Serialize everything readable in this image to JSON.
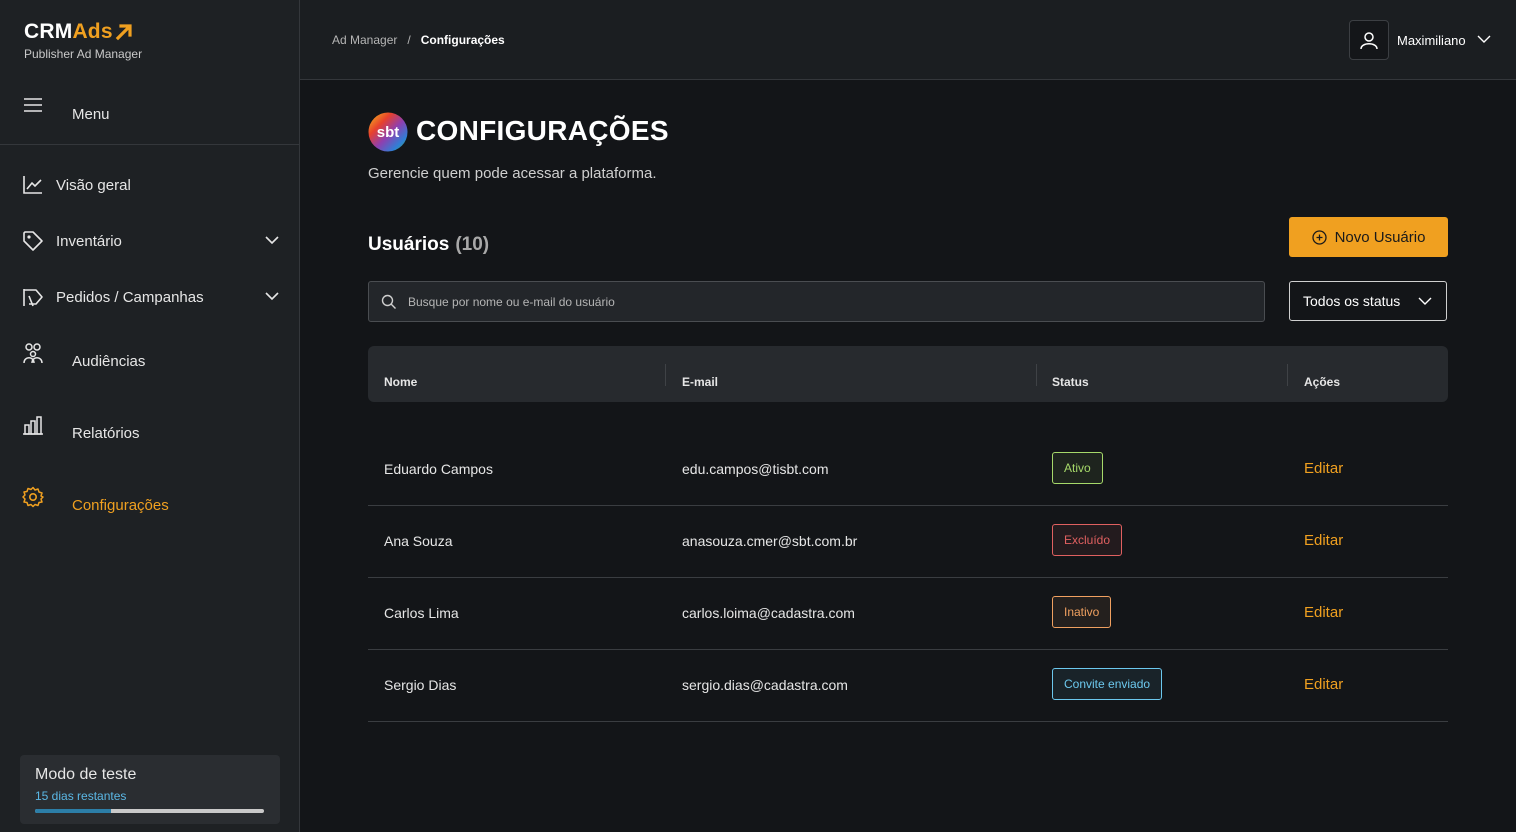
{
  "brand": {
    "crm": "CRM",
    "ads": "Ads",
    "subtitle": "Publisher Ad Manager"
  },
  "sidebar": {
    "menu_label": "Menu",
    "items": [
      {
        "label": "Visão geral",
        "icon": "chart-line-icon"
      },
      {
        "label": "Inventário",
        "icon": "tag-icon"
      },
      {
        "label": "Pedidos / Campanhas",
        "icon": "megaphone-icon"
      },
      {
        "label": "Audiências",
        "icon": "users-icon"
      },
      {
        "label": "Relatórios",
        "icon": "bar-chart-icon"
      },
      {
        "label": "Configurações",
        "icon": "gear-icon"
      }
    ],
    "trial": {
      "title": "Modo de teste",
      "days": "15 dias restantes",
      "progress": 0.33
    }
  },
  "header": {
    "breadcrumb": [
      "Ad Manager",
      "Configurações"
    ],
    "user_name": "Maximiliano"
  },
  "main": {
    "title": "CONFIGURAÇÕES",
    "subtitle": "Gerencie quem pode acessar a plataforma.",
    "users_label": "Usuários",
    "users_count": "(10)",
    "new_user_label": "Novo Usuário",
    "search_placeholder": "Busque por nome ou e-mail do usuário",
    "status_filter": "Todos os status",
    "columns": [
      "Nome",
      "E-mail",
      "Status",
      "Ações"
    ],
    "rows": [
      {
        "name": "Eduardo Campos",
        "email": "edu.campos@tisbt.com",
        "status": "Ativo",
        "action": "Editar"
      },
      {
        "name": "Ana Souza",
        "email": "anasouza.cmer@sbt.com.br",
        "status": "Excluído",
        "action": "Editar"
      },
      {
        "name": "Carlos Lima",
        "email": "carlos.loima@cadastra.com",
        "status": "Inativo",
        "action": "Editar"
      },
      {
        "name": "Sergio Dias",
        "email": "sergio.dias@cadastra.com",
        "status": "Convite enviado",
        "action": "Editar"
      }
    ]
  },
  "colors": {
    "accent": "#f0a020",
    "status_active": "#a6d96a",
    "status_deleted": "#e06060",
    "status_inactive": "#f0a060",
    "status_invited": "#6cc8ee"
  }
}
